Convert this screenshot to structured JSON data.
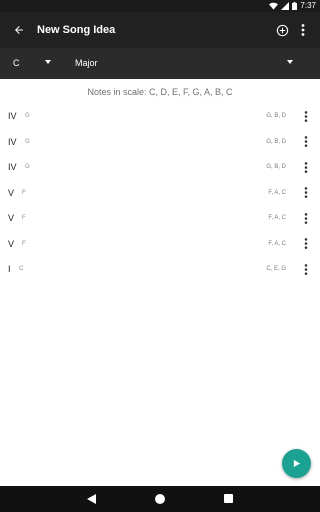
{
  "status_bar": {
    "time": "7:37"
  },
  "app_bar": {
    "title": "New Song Idea",
    "icons": {
      "back": "arrow-back-icon",
      "add": "add-circle-icon",
      "more": "more-vert-icon"
    }
  },
  "selectors": {
    "key": {
      "value": "C"
    },
    "mode": {
      "value": "Major"
    }
  },
  "scale_notes": "Notes in scale: C, D, E, F, G, A, B, C",
  "chords": [
    {
      "numeral": "IV",
      "chord": "G",
      "notes": "G, B, D"
    },
    {
      "numeral": "IV",
      "chord": "G",
      "notes": "G, B, D"
    },
    {
      "numeral": "IV",
      "chord": "G",
      "notes": "G, B, D"
    },
    {
      "numeral": "V",
      "chord": "F",
      "notes": "F, A, C"
    },
    {
      "numeral": "V",
      "chord": "F",
      "notes": "F, A, C"
    },
    {
      "numeral": "V",
      "chord": "F",
      "notes": "F, A, C"
    },
    {
      "numeral": "I",
      "chord": "C",
      "notes": "C, E, G"
    }
  ],
  "colors": {
    "fab": "#1ba293",
    "app_bar": "#212121",
    "select_bar": "#2b2b2b"
  }
}
